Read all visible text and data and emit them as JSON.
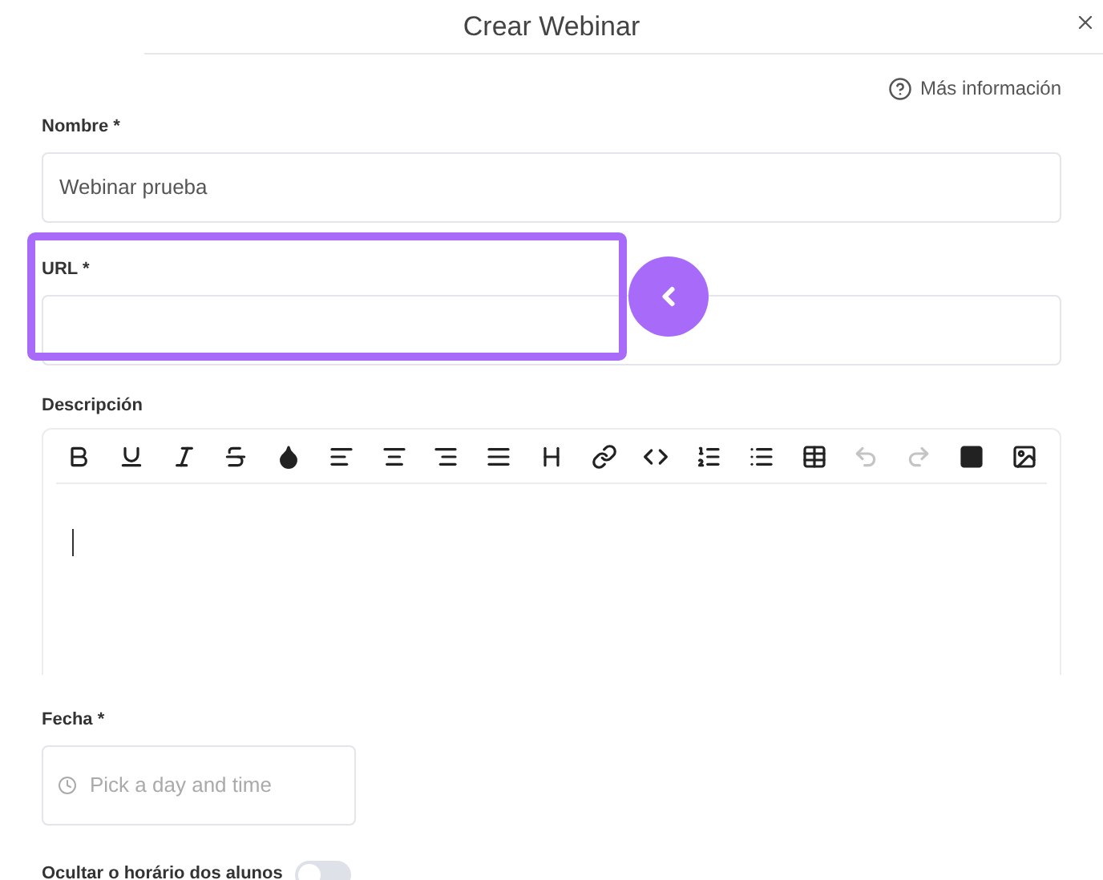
{
  "dialog": {
    "title": "Crear Webinar",
    "help_link": "Más información"
  },
  "fields": {
    "name": {
      "label": "Nombre *",
      "value": "Webinar prueba"
    },
    "url": {
      "label": "URL *",
      "highlighted": true
    },
    "description": {
      "label": "Descripción",
      "toolbar": [
        {
          "kind": "bold",
          "disabled": false
        },
        {
          "kind": "underline",
          "disabled": false
        },
        {
          "kind": "italic",
          "disabled": false
        },
        {
          "kind": "strike",
          "disabled": false
        },
        {
          "kind": "color",
          "disabled": false
        },
        {
          "kind": "align-left",
          "disabled": false
        },
        {
          "kind": "align-center",
          "disabled": false
        },
        {
          "kind": "align-right",
          "disabled": false
        },
        {
          "kind": "justify",
          "disabled": false
        },
        {
          "kind": "heading",
          "disabled": false
        },
        {
          "kind": "link",
          "disabled": false
        },
        {
          "kind": "code",
          "disabled": false
        },
        {
          "kind": "ordered-list",
          "disabled": false
        },
        {
          "kind": "bullet-list",
          "disabled": false
        },
        {
          "kind": "table",
          "disabled": false
        },
        {
          "kind": "undo",
          "disabled": true
        },
        {
          "kind": "redo",
          "disabled": true
        },
        {
          "kind": "block",
          "disabled": false
        },
        {
          "kind": "image",
          "disabled": false
        }
      ]
    },
    "date": {
      "label": "Fecha *",
      "placeholder": "Pick a day and time"
    },
    "hide_time": {
      "label": "Ocultar o horário dos alunos",
      "on": false
    }
  }
}
